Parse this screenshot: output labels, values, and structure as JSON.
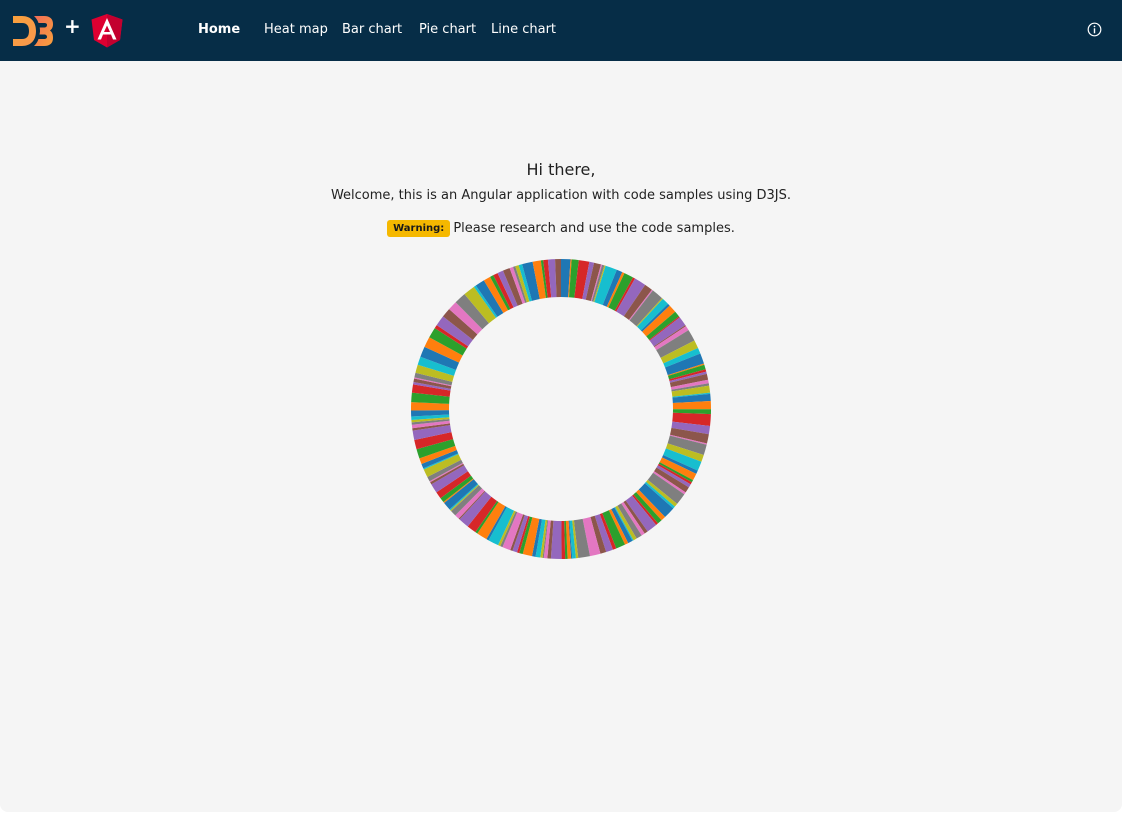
{
  "header": {
    "plus": "+",
    "nav": [
      {
        "label": "Home",
        "active": true
      },
      {
        "label": "Heat map",
        "active": false
      },
      {
        "label": "Bar chart",
        "active": false
      },
      {
        "label": "Pie chart",
        "active": false
      },
      {
        "label": "Line chart",
        "active": false
      }
    ],
    "info_icon": "info-circle-icon"
  },
  "main": {
    "greeting": "Hi there,",
    "welcome": "Welcome, this is an Angular application with code samples using D3JS.",
    "warning_badge": "Warning:",
    "warning_text": "Please research and use the code samples."
  },
  "chart_data": {
    "type": "pie",
    "style": "donut",
    "palette": [
      "#1f77b4",
      "#ff7f0e",
      "#2ca02c",
      "#d62728",
      "#9467bd",
      "#8c564b",
      "#e377c2",
      "#7f7f7f",
      "#bcbd22",
      "#17becf"
    ],
    "values": [
      8,
      1,
      6,
      9,
      4,
      6,
      1,
      2,
      1,
      10,
      5,
      2,
      8,
      2,
      10,
      7,
      1,
      10,
      1,
      6,
      2,
      7,
      5,
      1,
      8,
      1,
      4,
      10,
      7,
      5,
      9,
      1,
      4,
      2,
      2,
      5,
      3,
      2,
      6,
      1,
      6,
      7,
      4,
      10,
      7,
      8,
      1,
      9,
      6,
      8,
      3,
      6,
      2,
      2,
      3,
      5,
      2,
      10,
      3,
      2,
      10,
      4,
      4,
      2,
      9,
      3,
      3,
      5,
      3,
      1,
      4,
      3,
      8,
      3,
      6,
      5,
      9,
      10,
      2,
      3,
      1,
      3,
      2,
      3,
      9,
      3,
      3,
      1,
      2,
      4,
      3,
      8,
      3,
      2,
      4,
      2,
      7,
      2,
      2,
      9,
      2,
      9,
      2,
      8,
      9,
      1,
      4,
      5,
      1,
      1,
      7,
      1,
      4,
      6,
      8,
      2,
      1,
      4,
      7,
      1,
      4,
      5,
      8,
      8,
      8,
      2,
      3,
      2,
      2,
      3,
      5,
      7,
      8,
      7,
      2,
      3,
      1,
      4,
      7,
      7,
      9,
      9,
      9,
      3,
      9,
      8,
      8,
      10,
      10,
      2,
      8,
      6,
      3,
      4,
      5,
      6,
      3,
      2,
      3,
      3,
      9,
      7,
      2,
      4,
      6,
      5
    ]
  }
}
